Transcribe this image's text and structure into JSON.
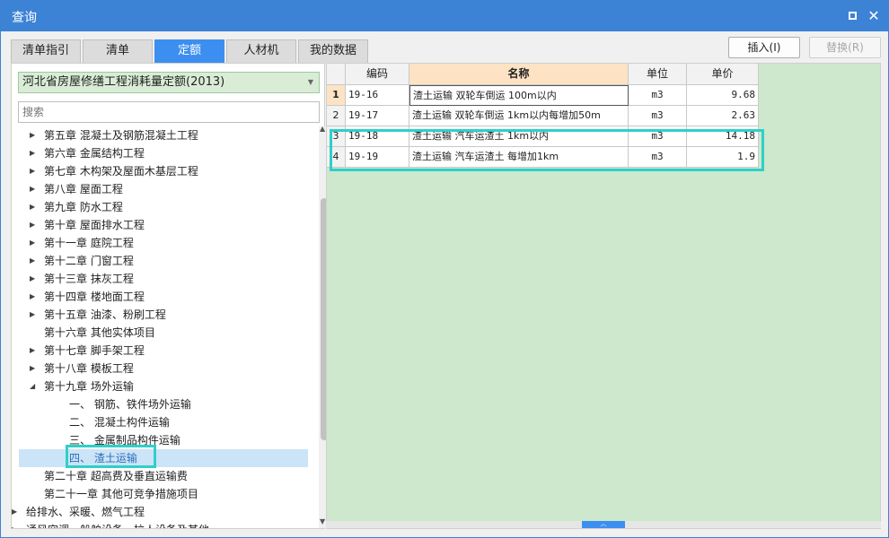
{
  "window": {
    "title": "查询"
  },
  "tabs": [
    {
      "label": "清单指引",
      "active": false
    },
    {
      "label": "清单",
      "active": false
    },
    {
      "label": "定额",
      "active": true
    },
    {
      "label": "人材机",
      "active": false
    },
    {
      "label": "我的数据",
      "active": false
    }
  ],
  "buttons": {
    "insert": "插入(I)",
    "replace": "替换(R)"
  },
  "library": {
    "selected": "河北省房屋修缮工程消耗量定额(2013)"
  },
  "search": {
    "placeholder": "搜索"
  },
  "tree": [
    {
      "label": "第五章 混凝土及钢筋混凝土工程",
      "level": 1,
      "expander": "right"
    },
    {
      "label": "第六章 金属结构工程",
      "level": 1,
      "expander": "right"
    },
    {
      "label": "第七章 木构架及屋面木基层工程",
      "level": 1,
      "expander": "right"
    },
    {
      "label": "第八章 屋面工程",
      "level": 1,
      "expander": "right"
    },
    {
      "label": "第九章 防水工程",
      "level": 1,
      "expander": "right"
    },
    {
      "label": "第十章 屋面排水工程",
      "level": 1,
      "expander": "right"
    },
    {
      "label": "第十一章 庭院工程",
      "level": 1,
      "expander": "right"
    },
    {
      "label": "第十二章 门窗工程",
      "level": 1,
      "expander": "right"
    },
    {
      "label": "第十三章 抹灰工程",
      "level": 1,
      "expander": "right"
    },
    {
      "label": "第十四章 楼地面工程",
      "level": 1,
      "expander": "right"
    },
    {
      "label": "第十五章 油漆、粉刷工程",
      "level": 1,
      "expander": "right"
    },
    {
      "label": "第十六章 其他实体项目",
      "level": 1,
      "expander": "none"
    },
    {
      "label": "第十七章 脚手架工程",
      "level": 1,
      "expander": "right"
    },
    {
      "label": "第十八章 模板工程",
      "level": 1,
      "expander": "right"
    },
    {
      "label": "第十九章 场外运输",
      "level": 1,
      "expander": "down"
    },
    {
      "label": "一、 钢筋、铁件场外运输",
      "level": 2,
      "expander": "none"
    },
    {
      "label": "二、 混凝土构件运输",
      "level": 2,
      "expander": "none"
    },
    {
      "label": "三、 金属制品构件运输",
      "level": 2,
      "expander": "none"
    },
    {
      "label": "四、 渣土运输",
      "level": 2,
      "expander": "none",
      "selected": true
    },
    {
      "label": "第二十章 超高费及垂直运输费",
      "level": 1,
      "expander": "none"
    },
    {
      "label": "第二十一章 其他可竞争措施项目",
      "level": 1,
      "expander": "none"
    },
    {
      "label": "给排水、采暖、燃气工程",
      "level": 0,
      "expander": "right"
    },
    {
      "label": "通风空调、船舶设备、拉人设备及其他",
      "level": 0,
      "expander": "right"
    }
  ],
  "grid": {
    "headers": {
      "code": "编码",
      "name": "名称",
      "unit": "单位",
      "price": "单价"
    },
    "rows": [
      {
        "idx": "1",
        "code": "19-16",
        "name": "渣土运输 双轮车倒运 100m以内",
        "unit": "m3",
        "price": "9.68"
      },
      {
        "idx": "2",
        "code": "19-17",
        "name": "渣土运输 双轮车倒运 1km以内每增加50m",
        "unit": "m3",
        "price": "2.63"
      },
      {
        "idx": "3",
        "code": "19-18",
        "name": "渣土运输 汽车运渣土 1km以内",
        "unit": "m3",
        "price": "14.18"
      },
      {
        "idx": "4",
        "code": "19-19",
        "name": "渣土运输 汽车运渣土 每增加1km",
        "unit": "m3",
        "price": "1.9"
      }
    ]
  },
  "colors": {
    "accent": "#3c83d6",
    "highlight": "#2fcfc9",
    "grid_bg": "#cde8cd"
  }
}
